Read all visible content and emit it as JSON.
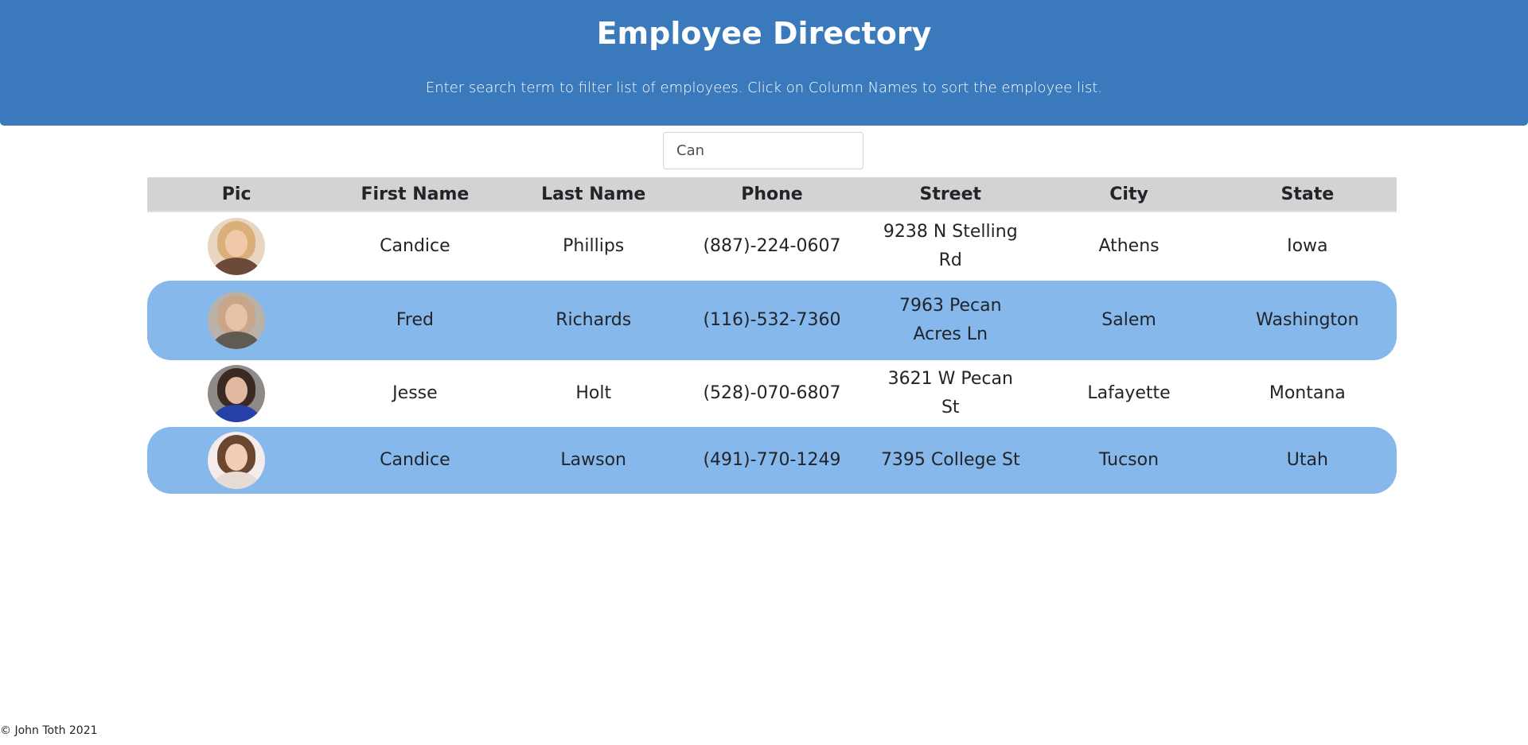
{
  "header": {
    "title": "Employee Directory",
    "subtitle": "Enter search term to filter list of employees. Click on Column Names to sort the employee list."
  },
  "search": {
    "value": "Can"
  },
  "table": {
    "columns": [
      "Pic",
      "First Name",
      "Last Name",
      "Phone",
      "Street",
      "City",
      "State"
    ],
    "rows": [
      {
        "first": "Candice",
        "last": "Phillips",
        "phone": "(887)-224-0607",
        "street": "9238 N Stelling Rd",
        "city": "Athens",
        "state": "Iowa",
        "avatar": {
          "bg": "#e9d6c2",
          "hair": "#d9b07a",
          "face": "#f0c9a8",
          "body": "#6b4a3a"
        }
      },
      {
        "first": "Fred",
        "last": "Richards",
        "phone": "(116)-532-7360",
        "street": "7963 Pecan Acres Ln",
        "city": "Salem",
        "state": "Washington",
        "avatar": {
          "bg": "#b9b2a8",
          "hair": "#c9a58a",
          "face": "#e8c2a6",
          "body": "#5f5a52"
        }
      },
      {
        "first": "Jesse",
        "last": "Holt",
        "phone": "(528)-070-6807",
        "street": "3621 W Pecan St",
        "city": "Lafayette",
        "state": "Montana",
        "avatar": {
          "bg": "#8d8a87",
          "hair": "#3b2a22",
          "face": "#e2b8a0",
          "body": "#2541a8"
        }
      },
      {
        "first": "Candice",
        "last": "Lawson",
        "phone": "(491)-770-1249",
        "street": "7395 College St",
        "city": "Tucson",
        "state": "Utah",
        "avatar": {
          "bg": "#f3ecea",
          "hair": "#6b4630",
          "face": "#f2cdb3",
          "body": "#e7dcd5"
        }
      }
    ]
  },
  "footer": {
    "text": "© John Toth 2021"
  },
  "colors": {
    "header_bg": "#3979bc",
    "row_alt_bg": "#86b8ec",
    "thead_bg": "#d3d3d3"
  }
}
